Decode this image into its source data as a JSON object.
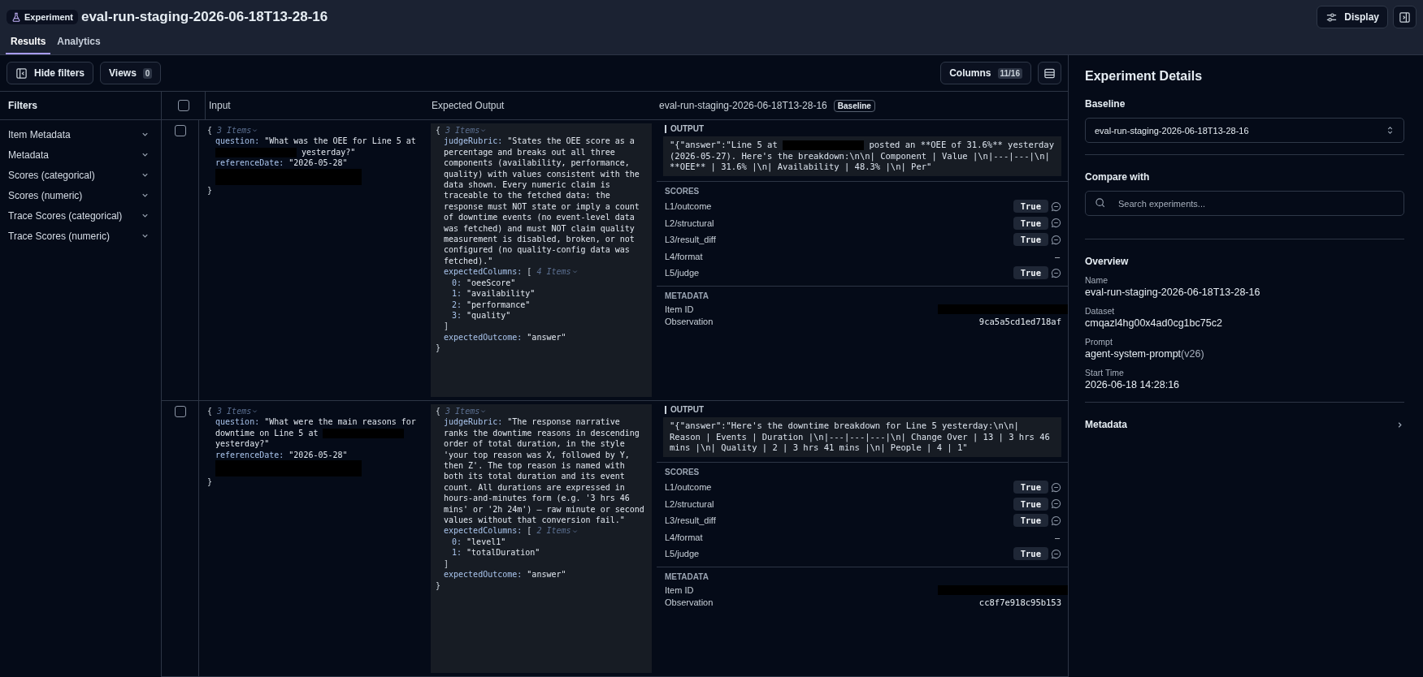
{
  "header": {
    "badge": "Experiment",
    "title": "eval-run-staging-2026-06-18T13-28-16",
    "display_button": "Display"
  },
  "tabs": [
    {
      "label": "Results",
      "selected": true
    },
    {
      "label": "Analytics",
      "selected": false
    }
  ],
  "toolbar": {
    "hide_filters": "Hide filters",
    "views": {
      "label": "Views",
      "count": "0"
    },
    "columns": {
      "label": "Columns",
      "count": "11/16"
    }
  },
  "filters": {
    "title": "Filters",
    "items": [
      "Item Metadata",
      "Metadata",
      "Scores (categorical)",
      "Scores (numeric)",
      "Trace Scores (categorical)",
      "Trace Scores (numeric)"
    ]
  },
  "table": {
    "select_all_checked": false,
    "columns": [
      "Input",
      "Expected Output"
    ],
    "run_column": {
      "title": "eval-run-staging-2026-06-18T13-28-16",
      "badge": "Baseline"
    },
    "rows": [
      {
        "checked": false,
        "input": {
          "open": "{",
          "close": "}",
          "count": "3 Items",
          "fields": [
            {
              "kind": "pair_redacted",
              "key": "question:",
              "before": "\"What was the OEE for Line 5 at",
              "after": "yesterday?\""
            },
            {
              "kind": "pair",
              "key": "referenceDate:",
              "value": "\"2026-05-28\""
            },
            {
              "kind": "redacted"
            }
          ]
        },
        "expected": {
          "open": "{",
          "close": "}",
          "count": "3 Items",
          "fields": [
            {
              "kind": "pair",
              "key": "judgeRubric:",
              "value": "\"States the OEE score as a percentage and breaks out all three components (availability, performance, quality) with values consistent with the data shown. Every numeric claim is traceable to the fetched data: the response must NOT state or imply a count of downtime events (no event-level data was fetched) and must NOT claim quality measurement is disabled, broken, or not configured (no quality-config data was fetched).\""
            },
            {
              "kind": "list",
              "key": "expectedColumns:",
              "open": "[",
              "close": "]",
              "count": "4 Items",
              "items": [
                {
                  "index": "0:",
                  "value": "\"oeeScore\""
                },
                {
                  "index": "1:",
                  "value": "\"availability\""
                },
                {
                  "index": "2:",
                  "value": "\"performance\""
                },
                {
                  "index": "3:",
                  "value": "\"quality\""
                }
              ]
            },
            {
              "kind": "pair",
              "key": "expectedOutcome:",
              "value": "\"answer\""
            }
          ]
        },
        "output": {
          "label": "OUTPUT",
          "parts": [
            {
              "kind": "text",
              "text": "\"{\"answer\":\"Line 5 at"
            },
            {
              "kind": "redacted"
            },
            {
              "kind": "text",
              "text": "posted an **OEE of 31.6%** yesterday (2026-05-27). Here's the breakdown:\\n\\n| Component | Value |\\n|---|---|\\n| **OEE** | 31.6% |\\n| Availability | 48.3% |\\n| Per\""
            }
          ]
        },
        "scores_label": "SCORES",
        "scores": [
          {
            "name": "L1/outcome",
            "kind": "badge",
            "value": "True"
          },
          {
            "name": "L2/structural",
            "kind": "badge",
            "value": "True"
          },
          {
            "name": "L3/result_diff",
            "kind": "badge",
            "value": "True"
          },
          {
            "name": "L4/format",
            "kind": "empty",
            "value": "–"
          },
          {
            "name": "L5/judge",
            "kind": "badge",
            "value": "True"
          }
        ],
        "metadata_label": "METADATA",
        "metadata": [
          {
            "key": "Item ID",
            "kind": "redacted"
          },
          {
            "key": "Observation",
            "kind": "text",
            "value": "9ca5a5cd1ed718af"
          }
        ]
      },
      {
        "checked": false,
        "input": {
          "open": "{",
          "close": "}",
          "count": "3 Items",
          "fields": [
            {
              "kind": "pair_redacted",
              "key": "question:",
              "before": "\"What were the main reasons for downtime on Line 5 at",
              "after": "yesterday?\""
            },
            {
              "kind": "pair",
              "key": "referenceDate:",
              "value": "\"2026-05-28\""
            },
            {
              "kind": "redacted"
            }
          ]
        },
        "expected": {
          "open": "{",
          "close": "}",
          "count": "3 Items",
          "fields": [
            {
              "kind": "pair",
              "key": "judgeRubric:",
              "value": "\"The response narrative ranks the downtime reasons in descending order of total duration, in the style 'your top reason was X, followed by Y, then Z'. The top reason is named with both its total duration and its event count. All durations are expressed in hours-and-minutes form (e.g. '3 hrs 46 mins' or '2h 24m') — raw minute or second values without that conversion fail.\""
            },
            {
              "kind": "list",
              "key": "expectedColumns:",
              "open": "[",
              "close": "]",
              "count": "2 Items",
              "items": [
                {
                  "index": "0:",
                  "value": "\"level1\""
                },
                {
                  "index": "1:",
                  "value": "\"totalDuration\""
                }
              ]
            },
            {
              "kind": "pair",
              "key": "expectedOutcome:",
              "value": "\"answer\""
            }
          ]
        },
        "output": {
          "label": "OUTPUT",
          "parts": [
            {
              "kind": "text",
              "text": "\"{\"answer\":\"Here's the downtime breakdown for Line 5 yesterday:\\n\\n| Reason | Events | Duration |\\n|---|---|---|\\n| Change Over | 13 | 3 hrs 46 mins |\\n| Quality | 2 | 3 hrs 41 mins |\\n| People | 4 | 1\""
            }
          ]
        },
        "scores_label": "SCORES",
        "scores": [
          {
            "name": "L1/outcome",
            "kind": "badge",
            "value": "True"
          },
          {
            "name": "L2/structural",
            "kind": "badge",
            "value": "True"
          },
          {
            "name": "L3/result_diff",
            "kind": "badge",
            "value": "True"
          },
          {
            "name": "L4/format",
            "kind": "empty",
            "value": "–"
          },
          {
            "name": "L5/judge",
            "kind": "badge",
            "value": "True"
          }
        ],
        "metadata_label": "METADATA",
        "metadata": [
          {
            "key": "Item ID",
            "kind": "redacted"
          },
          {
            "key": "Observation",
            "kind": "text",
            "value": "cc8f7e918c95b153"
          }
        ]
      }
    ]
  },
  "details": {
    "title": "Experiment Details",
    "baseline": {
      "label": "Baseline",
      "value": "eval-run-staging-2026-06-18T13-28-16"
    },
    "compare": {
      "label": "Compare with",
      "placeholder": "Search experiments..."
    },
    "overview": {
      "title": "Overview",
      "fields": [
        {
          "label": "Name",
          "value": "eval-run-staging-2026-06-18T13-28-16"
        },
        {
          "label": "Dataset",
          "value": "cmqazl4hg00x4ad0cg1bc75c2"
        },
        {
          "label": "Prompt",
          "value": "agent-system-prompt",
          "suffix": "(v26)"
        },
        {
          "label": "Start Time",
          "value": "2026-06-18 14:28:16"
        }
      ]
    },
    "metadata": "Metadata"
  }
}
